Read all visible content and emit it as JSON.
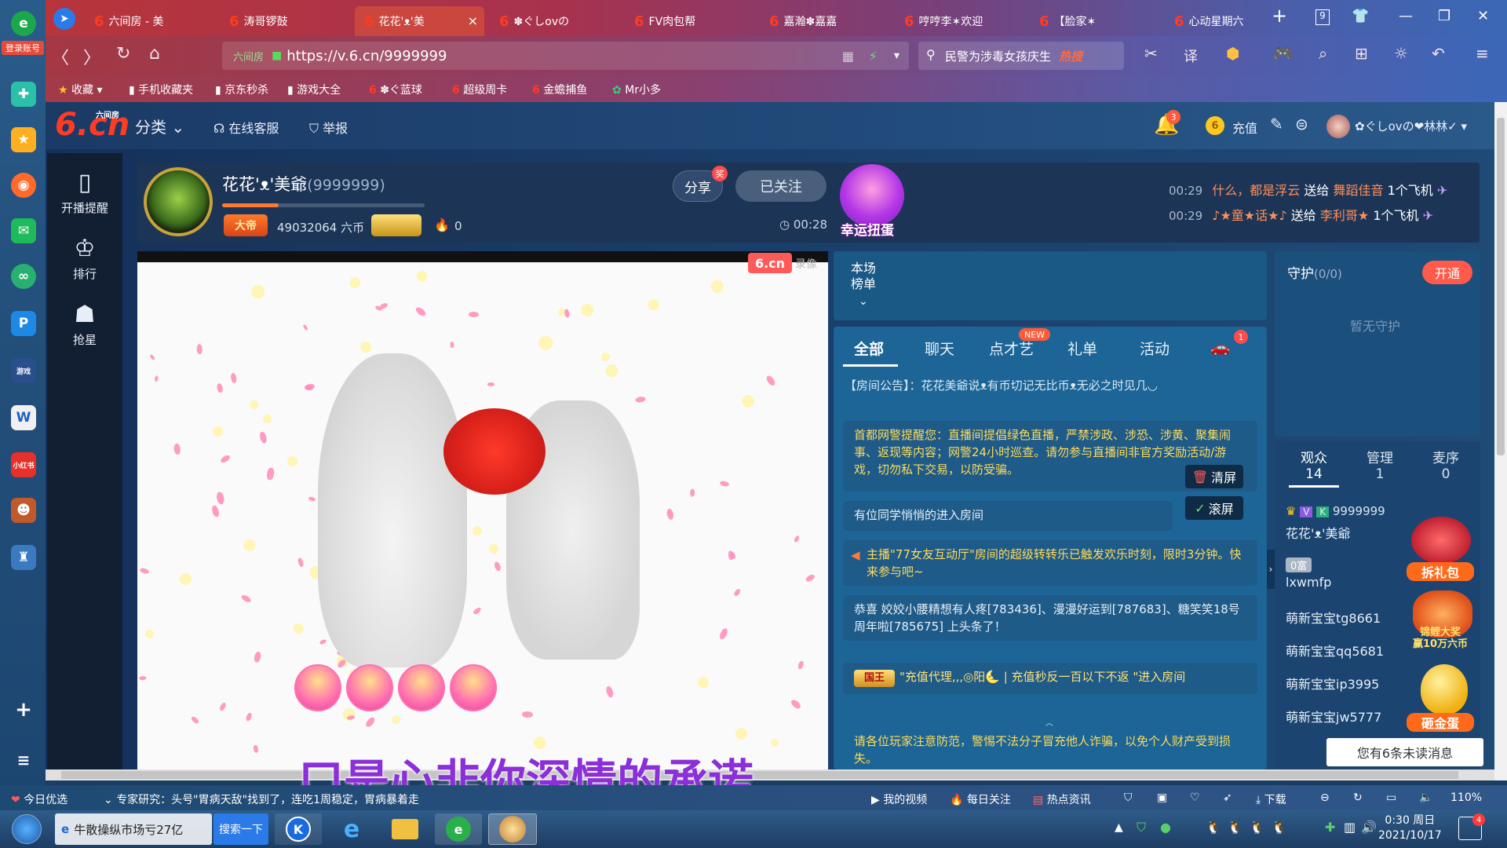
{
  "dock": {
    "login_label": "登录账号"
  },
  "tabs": [
    {
      "label": "六间房 - 美"
    },
    {
      "label": "涛哥锣鼓"
    },
    {
      "label": "花花'ᴥ'美"
    },
    {
      "label": "✽ぐしovの"
    },
    {
      "label": "FV肉包帮"
    },
    {
      "label": "嘉瀚✽嘉嘉"
    },
    {
      "label": "哼哼李✶欢迎"
    },
    {
      "label": "【脸家✶"
    },
    {
      "label": "心动星期六"
    }
  ],
  "tab_count": "9",
  "address": {
    "url": "https://v.6.cn/9999999",
    "prefix": "六间房"
  },
  "search": {
    "text": "民警为涉毒女孩庆生",
    "hot": "热搜"
  },
  "bookmarks": [
    "收藏",
    "手机收藏夹",
    "京东秒杀",
    "游戏大全",
    "✽ぐ蓝球",
    "超级周卡",
    "金蟾捕鱼",
    "Mr小多"
  ],
  "site": {
    "logo_main": "6.cn",
    "logo_small": "六间房",
    "nav_category": "分类",
    "nav_service": "在线客服",
    "nav_report": "举报",
    "bell_count": "3",
    "recharge": "充值",
    "user_name": "✿ぐしovの❤林林✓"
  },
  "sidenav": [
    "开播提醒",
    "排行",
    "抢星"
  ],
  "anchor": {
    "name": "花花'ᴥ'美爺",
    "room_id": "(9999999)",
    "rank_badge": "大帝",
    "coins": "49032064 六币",
    "fire_count": "0",
    "share": "分享",
    "share_badge": "奖",
    "follow": "已关注",
    "timer": "00:28",
    "lucky_label": "幸运扭蛋",
    "progress": 0.28
  },
  "gift_feed": [
    {
      "time": "00:29",
      "from": "什么，都是浮云",
      "verb": "送给",
      "to": "舞蹈佳音",
      "gift": "1个飞机"
    },
    {
      "time": "00:29",
      "from": "♪★童★话★♪",
      "verb": "送给",
      "to": "李利哥★",
      "gift": "1个飞机"
    }
  ],
  "video": {
    "watermark": "6.cn",
    "watermark2": "录像"
  },
  "rank_panel": {
    "title": "本场\n榜单"
  },
  "chat": {
    "tabs": [
      "全部",
      "聊天",
      "点才艺",
      "礼单",
      "活动"
    ],
    "new_badge": "NEW",
    "car_badge": "1",
    "announcement": "【房间公告】：花花美爺说ᴥ有币切记无比币ᴥ无必之时见几◡",
    "messages": [
      {
        "text": "首都网警提醒您：直播间提倡绿色直播，严禁涉政、涉恐、涉黄、聚集闹事、返现等内容；网警24小时巡查。请勿参与直播间非官方奖励活动/游戏，切勿私下交易，以防受骗。"
      },
      {
        "text": "有位同学悄悄的进入房间"
      },
      {
        "text": "主播\"77女友互动厅\"房间的超级转转乐已触发欢乐时刻，限时3分钟。快来参与吧~"
      },
      {
        "text": "恭喜 姣姣小腰精想有人疼[783436]、漫漫好运到[787683]、糖笑笑18号周年啦[785675] 上头条了！"
      },
      {
        "text": "\"充值代理,,,◎阳🌜 | 充值秒反一百以下不返 \"进入房间",
        "badge": "国王"
      },
      {
        "text": "请各位玩家注意防范，警惕不法分子冒充他人诈骗，以免个人财产受到损失。"
      }
    ],
    "clear_btn": "清屏",
    "scroll_btn": "滚屏"
  },
  "guard": {
    "title": "守护",
    "count": "(0/0)",
    "open": "开通",
    "empty": "暂无守护"
  },
  "audience": {
    "tabs": [
      {
        "label": "观众",
        "count": "14"
      },
      {
        "label": "管理",
        "count": "1"
      },
      {
        "label": "麦序",
        "count": "0"
      }
    ],
    "list": [
      {
        "name": "花花'ᴥ'美爺",
        "id": "9999999"
      },
      {
        "name": "lxwmfp",
        "badge": "0富"
      },
      {
        "name": "萌新宝宝tg8661"
      },
      {
        "name": "萌新宝宝qq5681"
      },
      {
        "name": "萌新宝宝ip3995"
      },
      {
        "name": "萌新宝宝jw5777"
      }
    ],
    "promos": [
      "拆礼包",
      "锦鲤大奖\n赢10万六币",
      "砸金蛋"
    ]
  },
  "unread": "您有6条未读消息",
  "lyric": "口是心非你深情的承诺",
  "statusbar": {
    "left1": "今日优选",
    "news": "专家研究：头号\"胃病天敌\"找到了，连吃1周稳定，胃病暴着走",
    "my_video": "我的视频",
    "daily": "每日关注",
    "hot": "热点资讯",
    "download": "下载",
    "zoom": "110%"
  },
  "taskbar": {
    "ie_text": "牛散操纵市场亏27亿",
    "search_btn": "搜索一下",
    "time": "0:30 周日",
    "date": "2021/10/17",
    "notif": "4"
  }
}
